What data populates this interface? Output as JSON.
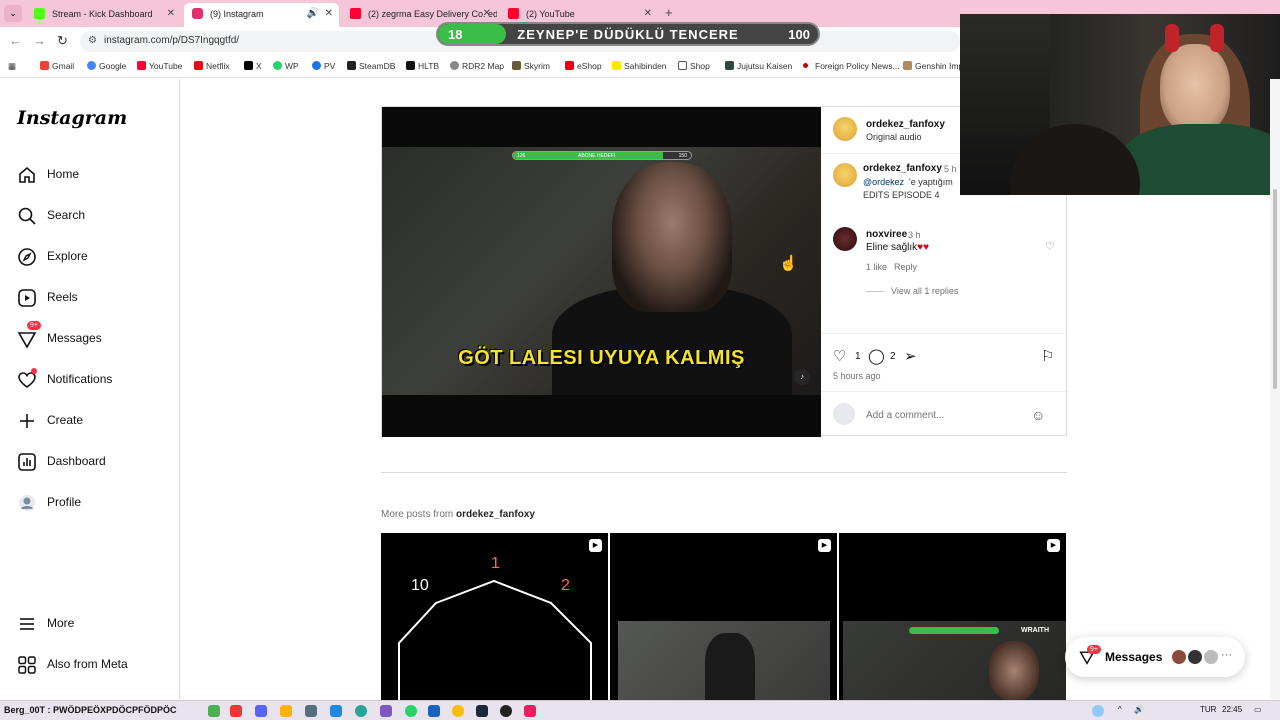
{
  "browser": {
    "tabs": [
      {
        "label": "Stream - Kick Dashboard",
        "color": "#53fc18"
      },
      {
        "label": "(9) Instagram",
        "color": "#e1306c"
      },
      {
        "label": "(2) zegrma Easy Delivery Co. ed",
        "color": "#ff0033"
      },
      {
        "label": "(2) YouTube",
        "color": "#ff0033"
      }
    ],
    "url": "instagram.com/p/DS7Ingqgtfd/",
    "bookmarks": [
      "Gmail",
      "Google",
      "YouTube",
      "Netflix",
      "X",
      "WP",
      "PV",
      "SteamDB",
      "HLTB",
      "RDR2 Map",
      "Skyrim",
      "eShop",
      "Sahibinden",
      "Shop",
      "Jujutsu Kaisen",
      "Foreign Policy News...",
      "Genshin Imp"
    ]
  },
  "goal_overlay": {
    "current": "18",
    "title": "ZEYNEP'E DÜDÜKLÜ TENCERE",
    "max": "100",
    "progress": 0.18
  },
  "sidebar": {
    "logo": "Instagram",
    "items": [
      {
        "label": "Home",
        "icon": "home-icon"
      },
      {
        "label": "Search",
        "icon": "search-icon"
      },
      {
        "label": "Explore",
        "icon": "compass-icon"
      },
      {
        "label": "Reels",
        "icon": "reels-icon"
      },
      {
        "label": "Messages",
        "icon": "messenger-icon",
        "badge": "9+"
      },
      {
        "label": "Notifications",
        "icon": "heart-icon"
      },
      {
        "label": "Create",
        "icon": "plus-icon"
      },
      {
        "label": "Dashboard",
        "icon": "chart-icon"
      },
      {
        "label": "Profile",
        "icon": "avatar-icon"
      }
    ],
    "more": "More",
    "meta": "Also from Meta"
  },
  "post": {
    "video": {
      "goal_label": "ABONE HEDEFİ",
      "goal_current": "126",
      "goal_max": "150",
      "caption": "GÖT LALESI UYUYA KALMIŞ"
    },
    "author": "ordekez_fanfoxy",
    "audio": "Original audio",
    "caption_comment": {
      "user": "ordekez_fanfoxy",
      "time": "5 h",
      "mention": "@ordekez",
      "text": " 'e yaptığım",
      "line2": "EDITS EPISODE 4"
    },
    "comment": {
      "user": "noxviree",
      "time": "3 h",
      "text": "Eline sağlık",
      "likes": "1 like",
      "reply": "Reply",
      "view_replies": "View all 1 replies"
    },
    "like_count": "1",
    "comment_count": "2",
    "posted": "5 hours ago",
    "add_comment_placeholder": "Add a comment..."
  },
  "more_posts": {
    "prefix": "More posts from ",
    "user": "ordekez_fanfoxy"
  },
  "grid": [
    {
      "label": "10",
      "label2": "1",
      "label3": "2"
    },
    {},
    {
      "goal": "WRAITH"
    }
  ],
  "messages_pill": {
    "label": "Messages",
    "badge": "9+"
  },
  "taskbar": {
    "ticker": "Berg_00T : PWÖDPEÖXPDÖCPFÖDPÖC",
    "lang": "TUR",
    "time": "22:45"
  }
}
